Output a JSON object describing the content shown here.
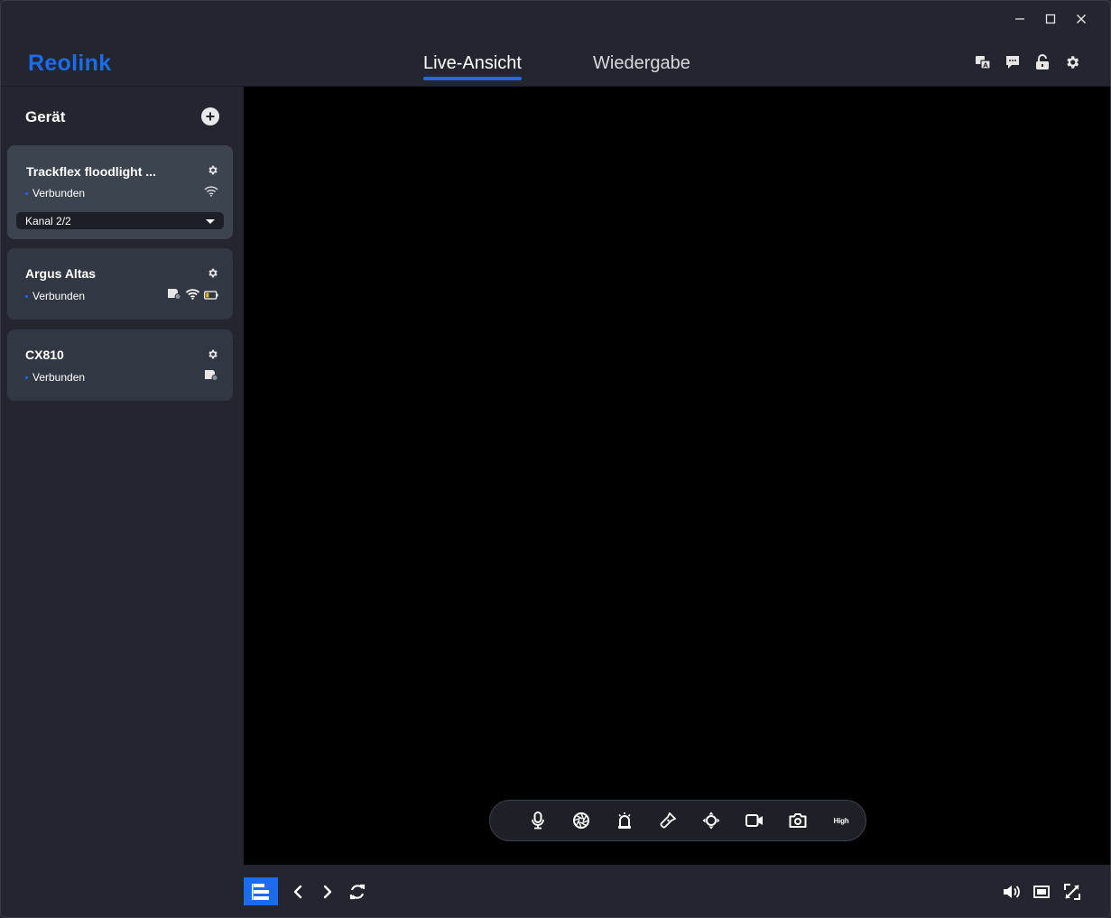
{
  "app": {
    "logo_text": "Reolink",
    "accent_color": "#1b6cf0"
  },
  "window_controls": [
    "minimize-icon",
    "maximize-icon",
    "close-icon"
  ],
  "nav": {
    "tabs": [
      {
        "label": "Live-Ansicht",
        "active": true
      },
      {
        "label": "Wiedergabe",
        "active": false
      }
    ]
  },
  "header_icons": [
    "language-icon",
    "message-icon",
    "unlock-icon",
    "settings-icon"
  ],
  "sidebar": {
    "title": "Gerät",
    "devices": [
      {
        "name": "Trackflex floodlight ...",
        "status": "Verbunden",
        "icons": [
          "wifi-icon"
        ],
        "channel": "Kanal 2/2",
        "selected": true
      },
      {
        "name": "Argus Altas",
        "status": "Verbunden",
        "icons": [
          "storage-icon",
          "wifi-icon",
          "battery-icon"
        ],
        "selected": false
      },
      {
        "name": "CX810",
        "status": "Verbunden",
        "icons": [
          "storage-icon"
        ],
        "selected": false
      }
    ]
  },
  "toolbar": {
    "tools": [
      "microphone-icon",
      "aperture-icon",
      "siren-icon",
      "flashlight-icon",
      "ptz-icon",
      "record-icon",
      "snapshot-icon"
    ],
    "quality_label": "High"
  },
  "bottom_bar": {
    "left_icons": [
      "layout-icon",
      "previous-icon",
      "next-icon",
      "refresh-icon"
    ],
    "right_icons": [
      "volume-icon",
      "aspect-ratio-icon",
      "fullscreen-icon"
    ]
  }
}
